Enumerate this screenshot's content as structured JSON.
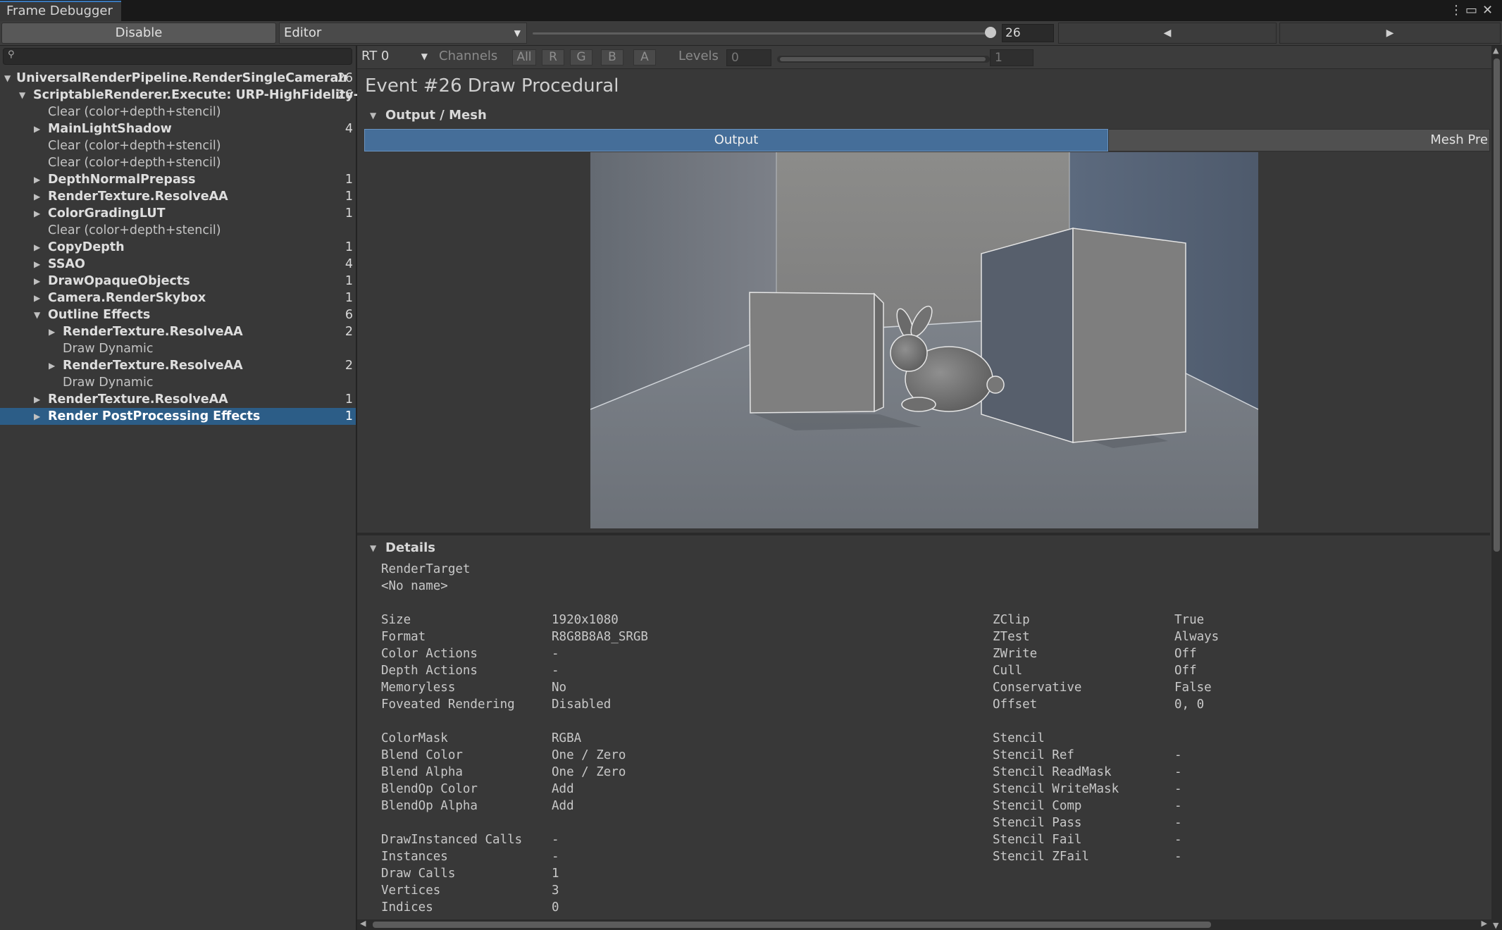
{
  "window": {
    "tab_title": "Frame Debugger",
    "menu_icon": "kebab-menu-icon",
    "maximize_icon": "maximize-icon",
    "close_icon": "close-icon"
  },
  "toolbar": {
    "disable_label": "Disable",
    "target_dropdown": "Editor",
    "frame_index": "26",
    "prev_icon": "triangle-left-icon",
    "next_icon": "triangle-right-icon"
  },
  "search": {
    "value": "",
    "icon": "search-icon"
  },
  "tree": [
    {
      "label": "UniversalRenderPipeline.RenderSingleCameraInte",
      "count": "26",
      "indent": 0,
      "expanded": true,
      "bold": true
    },
    {
      "label": "ScriptableRenderer.Execute: URP-HighFidelity-",
      "count": "26",
      "indent": 1,
      "expanded": true,
      "bold": true
    },
    {
      "label": "Clear (color+depth+stencil)",
      "count": "",
      "indent": 2,
      "leaf": true
    },
    {
      "label": "MainLightShadow",
      "count": "4",
      "indent": 2,
      "expanded": false,
      "bold": true
    },
    {
      "label": "Clear (color+depth+stencil)",
      "count": "",
      "indent": 2,
      "leaf": true
    },
    {
      "label": "Clear (color+depth+stencil)",
      "count": "",
      "indent": 2,
      "leaf": true
    },
    {
      "label": "DepthNormalPrepass",
      "count": "1",
      "indent": 2,
      "expanded": false,
      "bold": true
    },
    {
      "label": "RenderTexture.ResolveAA",
      "count": "1",
      "indent": 2,
      "expanded": false,
      "bold": true
    },
    {
      "label": "ColorGradingLUT",
      "count": "1",
      "indent": 2,
      "expanded": false,
      "bold": true
    },
    {
      "label": "Clear (color+depth+stencil)",
      "count": "",
      "indent": 2,
      "leaf": true
    },
    {
      "label": "CopyDepth",
      "count": "1",
      "indent": 2,
      "expanded": false,
      "bold": true
    },
    {
      "label": "SSAO",
      "count": "4",
      "indent": 2,
      "expanded": false,
      "bold": true
    },
    {
      "label": "DrawOpaqueObjects",
      "count": "1",
      "indent": 2,
      "expanded": false,
      "bold": true
    },
    {
      "label": "Camera.RenderSkybox",
      "count": "1",
      "indent": 2,
      "expanded": false,
      "bold": true
    },
    {
      "label": "Outline Effects",
      "count": "6",
      "indent": 2,
      "expanded": true,
      "bold": true
    },
    {
      "label": "RenderTexture.ResolveAA",
      "count": "2",
      "indent": 3,
      "expanded": false,
      "bold": true
    },
    {
      "label": "Draw Dynamic",
      "count": "",
      "indent": 3,
      "leaf": true
    },
    {
      "label": "RenderTexture.ResolveAA",
      "count": "2",
      "indent": 3,
      "expanded": false,
      "bold": true
    },
    {
      "label": "Draw Dynamic",
      "count": "",
      "indent": 3,
      "leaf": true
    },
    {
      "label": "RenderTexture.ResolveAA",
      "count": "1",
      "indent": 2,
      "expanded": false,
      "bold": true
    },
    {
      "label": "Render PostProcessing Effects",
      "count": "1",
      "indent": 2,
      "expanded": false,
      "bold": true,
      "selected": true
    }
  ],
  "rt_toolbar": {
    "rt_select": "RT 0",
    "channels_label": "Channels",
    "channels": [
      "All",
      "R",
      "G",
      "B",
      "A"
    ],
    "levels_label": "Levels",
    "level_min": "0",
    "level_max": "1"
  },
  "event": {
    "title": "Event #26 Draw Procedural",
    "output_mesh_header": "Output / Mesh",
    "output_tab": "Output",
    "mesh_tab": "Mesh Pre",
    "details_header": "Details"
  },
  "details": {
    "render_target_label": "RenderTarget",
    "render_target_name": "<No name>",
    "left_rows": [
      {
        "k": "Size",
        "v": "1920x1080"
      },
      {
        "k": "Format",
        "v": "R8G8B8A8_SRGB"
      },
      {
        "k": "Color Actions",
        "v": "-"
      },
      {
        "k": "Depth Actions",
        "v": "-"
      },
      {
        "k": "Memoryless",
        "v": "No"
      },
      {
        "k": "Foveated Rendering",
        "v": "Disabled"
      },
      {
        "k": "",
        "v": ""
      },
      {
        "k": "ColorMask",
        "v": "RGBA"
      },
      {
        "k": "Blend Color",
        "v": "One / Zero"
      },
      {
        "k": "Blend Alpha",
        "v": "One / Zero"
      },
      {
        "k": "BlendOp Color",
        "v": "Add"
      },
      {
        "k": "BlendOp Alpha",
        "v": "Add"
      },
      {
        "k": "",
        "v": ""
      },
      {
        "k": "DrawInstanced Calls",
        "v": "-"
      },
      {
        "k": "Instances",
        "v": "-"
      },
      {
        "k": "Draw Calls",
        "v": "1"
      },
      {
        "k": "Vertices",
        "v": "3"
      },
      {
        "k": "Indices",
        "v": "0"
      }
    ],
    "right_rows": [
      {
        "k": "ZClip",
        "v": "True"
      },
      {
        "k": "ZTest",
        "v": "Always"
      },
      {
        "k": "ZWrite",
        "v": "Off"
      },
      {
        "k": "Cull",
        "v": "Off"
      },
      {
        "k": "Conservative",
        "v": "False"
      },
      {
        "k": "Offset",
        "v": "0, 0"
      },
      {
        "k": "",
        "v": ""
      },
      {
        "k": "Stencil",
        "v": ""
      },
      {
        "k": "Stencil Ref",
        "v": "-"
      },
      {
        "k": "Stencil ReadMask",
        "v": "-"
      },
      {
        "k": "Stencil WriteMask",
        "v": "-"
      },
      {
        "k": "Stencil Comp",
        "v": "-"
      },
      {
        "k": "Stencil Pass",
        "v": "-"
      },
      {
        "k": "Stencil Fail",
        "v": "-"
      },
      {
        "k": "Stencil ZFail",
        "v": "-"
      }
    ]
  },
  "colors": {
    "selection": "#2c5d87",
    "tab_accent": "#3a79bb",
    "output_tab": "#456e99"
  }
}
